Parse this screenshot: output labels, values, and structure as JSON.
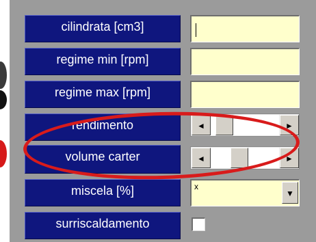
{
  "form": {
    "fields": [
      {
        "label": "cilindrata [cm3]",
        "value": ""
      },
      {
        "label": "regime min [rpm]",
        "value": ""
      },
      {
        "label": "regime max [rpm]",
        "value": ""
      },
      {
        "label": "rendimento"
      },
      {
        "label": "volume carter"
      },
      {
        "label": "miscela [%]",
        "value": "x"
      },
      {
        "label": "surriscaldamento",
        "checked": false
      }
    ]
  },
  "scrollbars": {
    "left_arrow": "◄",
    "right_arrow": "►",
    "rendimento_level": 0.12,
    "volume_carter_level": 0.3
  },
  "combo": {
    "arrow": "▼"
  },
  "colors": {
    "label_bg": "#0f167e",
    "input_bg": "#ffffcc",
    "annotation": "#d81b1b",
    "background": "#9b9b9b"
  }
}
